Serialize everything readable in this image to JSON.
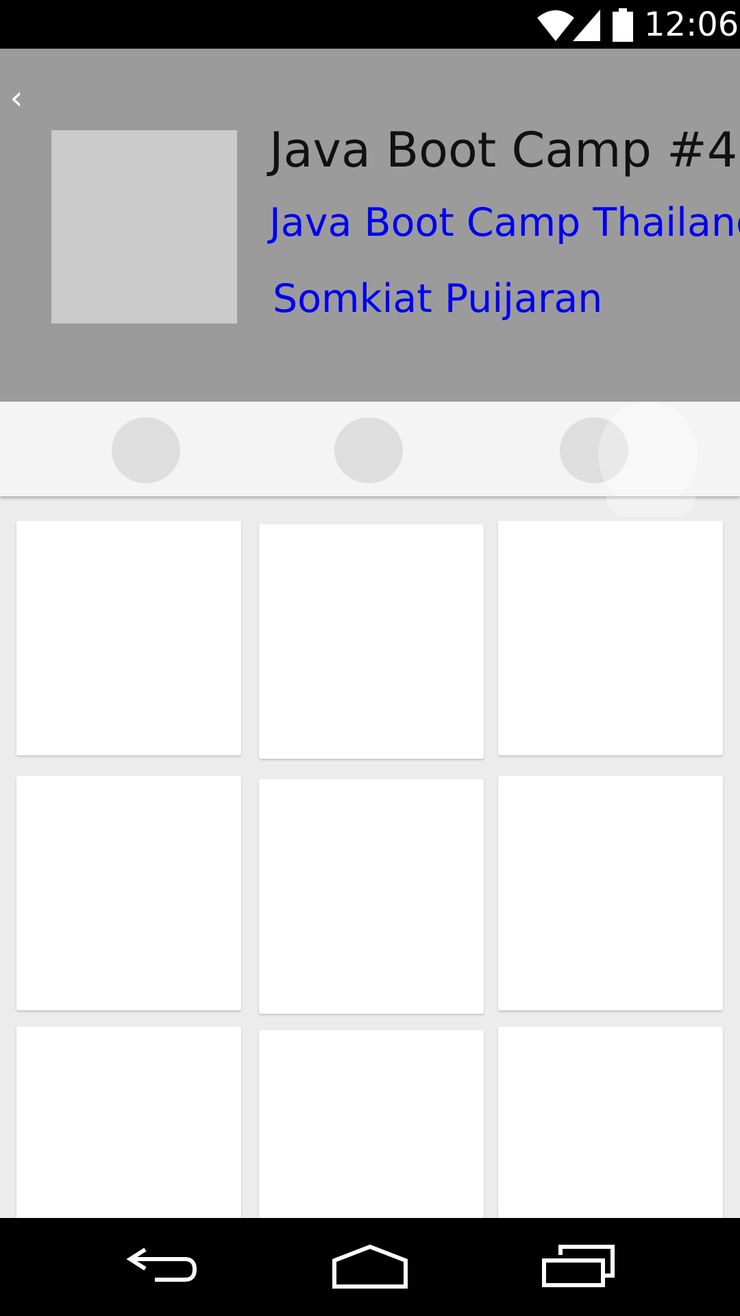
{
  "status_bar": {
    "time": "12:06",
    "icons": [
      "wifi-icon",
      "cell-signal-icon",
      "battery-icon"
    ]
  },
  "header": {
    "back_glyph": "‹",
    "title": "Java Boot Camp #4",
    "group_link": "Java Boot Camp Thailand",
    "organizer_link": "Somkiat Puijaran"
  },
  "tabs": [
    {
      "id": "tab-1"
    },
    {
      "id": "tab-2"
    },
    {
      "id": "tab-3"
    }
  ],
  "grid": {
    "columns": 3,
    "visible_rows": 3,
    "cards": 9
  },
  "nav_bar": {
    "icons": [
      "back-icon",
      "home-icon",
      "recent-apps-icon"
    ]
  },
  "colors": {
    "header_bg": "#9c9b9c",
    "link": "#0000f0",
    "title": "#111111",
    "page_bg": "#ececec"
  }
}
